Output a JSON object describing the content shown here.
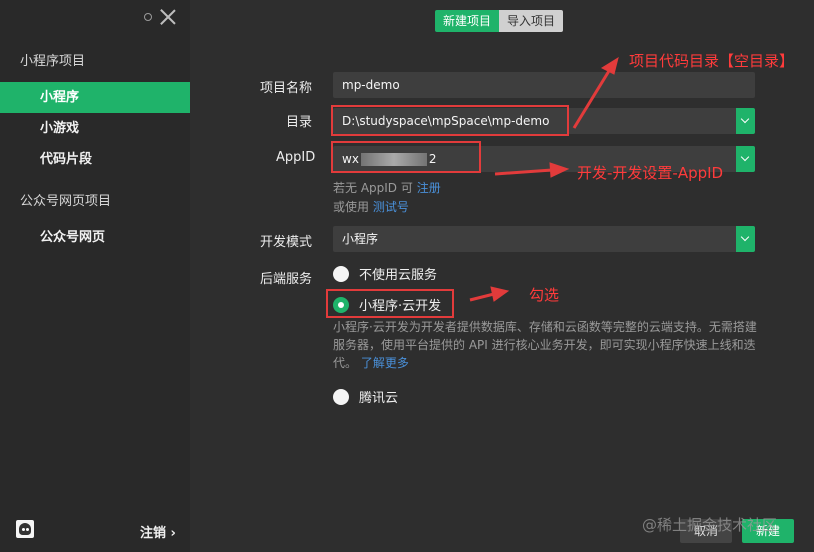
{
  "sidebar": {
    "group1_title": "小程序项目",
    "items": [
      {
        "label": "小程序"
      },
      {
        "label": "小游戏"
      },
      {
        "label": "代码片段"
      }
    ],
    "group2_title": "公众号网页项目",
    "items2": [
      {
        "label": "公众号网页"
      }
    ],
    "logout": "注销 ›"
  },
  "tabs": [
    {
      "label": "新建项目"
    },
    {
      "label": "导入项目"
    }
  ],
  "form": {
    "name_label": "项目名称",
    "name_value": "mp-demo",
    "dir_label": "目录",
    "dir_value": "D:\\studyspace\\mpSpace\\mp-demo",
    "appid_label": "AppID",
    "appid_prefix": "wx",
    "appid_suffix": "2",
    "hint1_text": "若无 AppID 可",
    "hint1_link": "注册",
    "hint2_text": "或使用",
    "hint2_link": "测试号",
    "mode_label": "开发模式",
    "mode_value": "小程序",
    "backend_label": "后端服务",
    "radio1": "不使用云服务",
    "radio2": "小程序·云开发",
    "radio3": "腾讯云",
    "desc": "小程序·云开发为开发者提供数据库、存储和云函数等完整的云端支持。无需搭建服务器，使用平台提供的 API 进行核心业务开发，即可实现小程序快速上线和迭代。",
    "desc_link": "了解更多"
  },
  "buttons": {
    "cancel": "取消",
    "create": "新建"
  },
  "annotations": {
    "dir_note": "项目代码目录【空目录】",
    "appid_note": "开发-开发设置-AppID",
    "check_note": "勾选"
  },
  "watermark": "@稀土掘金技术社区",
  "colors": {
    "accent": "#1fb36a",
    "annotation": "#e23b3b",
    "link": "#4a90d9"
  }
}
